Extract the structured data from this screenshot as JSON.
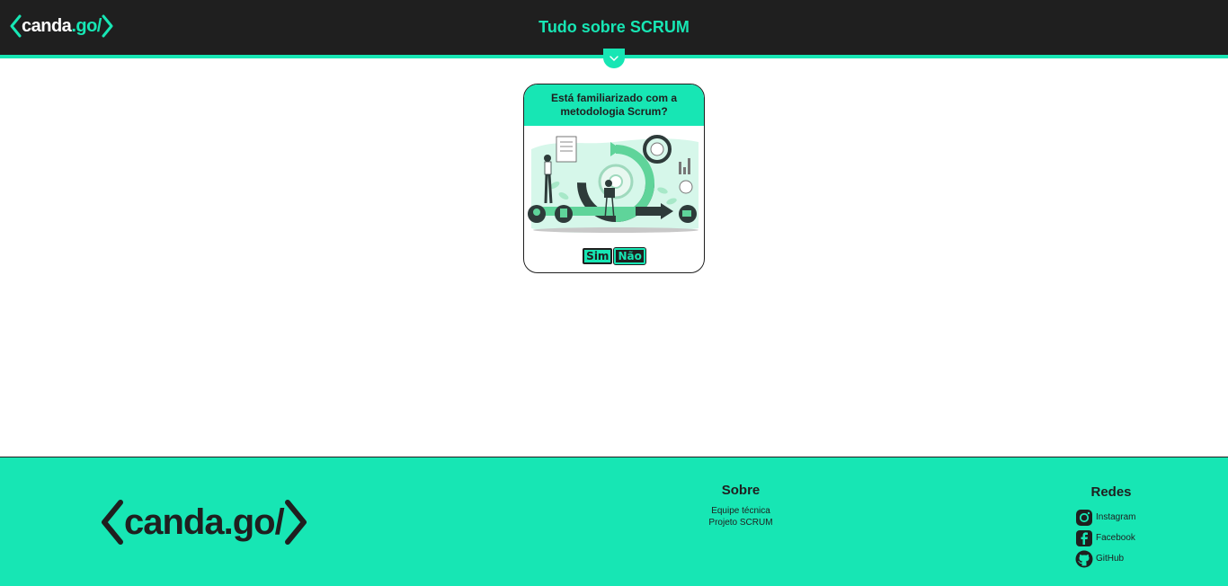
{
  "header": {
    "logo_text": "canda",
    "logo_suffix": ".go/",
    "title": "Tudo sobre SCRUM"
  },
  "card": {
    "question": "Está familiarizado com a metodologia Scrum?",
    "yes_label": "Sim",
    "no_label": "Não",
    "illustration_icon": "scrum-cycle-illustration"
  },
  "footer": {
    "logo_text": "canda.go/",
    "sobre": {
      "title": "Sobre",
      "links": [
        "Equipe técnica",
        "Projeto SCRUM"
      ]
    },
    "redes": {
      "title": "Redes",
      "items": [
        {
          "label": "Instagram",
          "icon": "instagram-icon"
        },
        {
          "label": "Facebook",
          "icon": "facebook-icon"
        },
        {
          "label": "GitHub",
          "icon": "github-icon"
        }
      ]
    }
  },
  "colors": {
    "accent": "#17e6b4",
    "dark": "#1f1f1f",
    "background": "#ffffff"
  }
}
